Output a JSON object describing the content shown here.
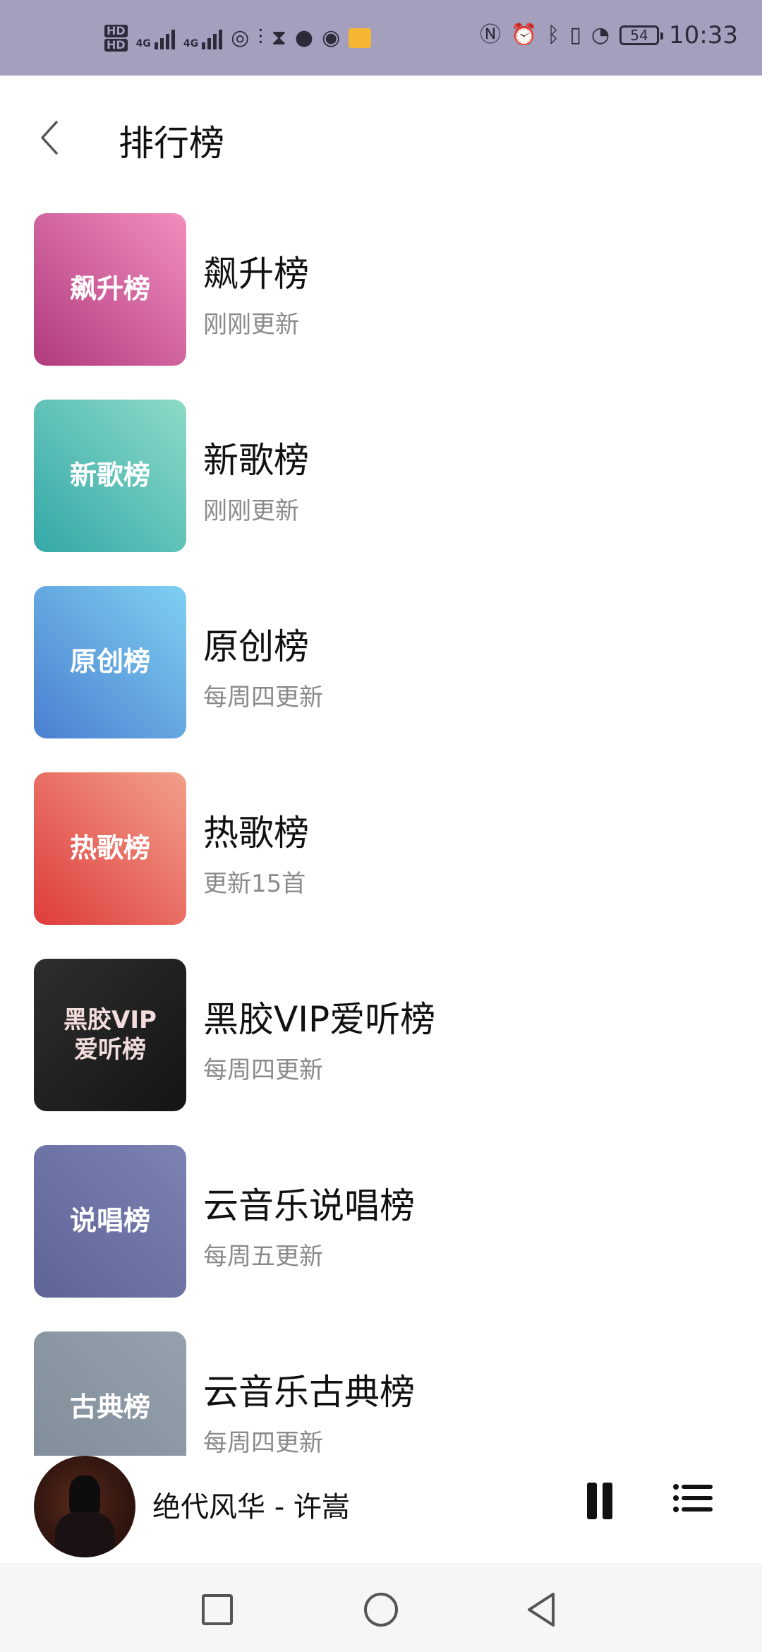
{
  "status_bar": {
    "hd1": "HD",
    "hd2": "HD",
    "net1": "4G",
    "net2": "4G",
    "battery": "54",
    "time": "10:33",
    "icons": [
      "signal-icon",
      "wifi-icon",
      "hourglass-icon",
      "message-icon",
      "browser-icon",
      "mail-icon",
      "nfc-icon",
      "alarm-icon",
      "bluetooth-icon",
      "vibrate-icon",
      "speed-icon",
      "battery-icon"
    ]
  },
  "header": {
    "title": "排行榜"
  },
  "charts": [
    {
      "cover_text": "飙升榜",
      "name": "飙升榜",
      "subtitle": "刚刚更新",
      "colors": [
        "#b03a7e",
        "#f28fbe"
      ]
    },
    {
      "cover_text": "新歌榜",
      "name": "新歌榜",
      "subtitle": "刚刚更新",
      "colors": [
        "#33a8a8",
        "#8ddbc8"
      ]
    },
    {
      "cover_text": "原创榜",
      "name": "原创榜",
      "subtitle": "每周四更新",
      "colors": [
        "#4a7fd0",
        "#7fd0f2"
      ]
    },
    {
      "cover_text": "热歌榜",
      "name": "热歌榜",
      "subtitle": "更新15首",
      "colors": [
        "#de3c3c",
        "#f2a08a"
      ]
    },
    {
      "cover_text_line1": "黑胶VIP",
      "cover_text_line2": "爱听榜",
      "name": "黑胶VIP爱听榜",
      "subtitle": "每周四更新",
      "colors": [
        "#141414",
        "#2e2e2e"
      ]
    },
    {
      "cover_text": "说唱榜",
      "name": "云音乐说唱榜",
      "subtitle": "每周五更新",
      "colors": [
        "#5f6496",
        "#7b83b3"
      ]
    },
    {
      "cover_text": "古典榜",
      "name": "云音乐古典榜",
      "subtitle": "每周四更新",
      "colors": [
        "#7f8c99",
        "#95a1ac"
      ]
    }
  ],
  "player": {
    "now_playing": "绝代风华 - 许嵩"
  }
}
